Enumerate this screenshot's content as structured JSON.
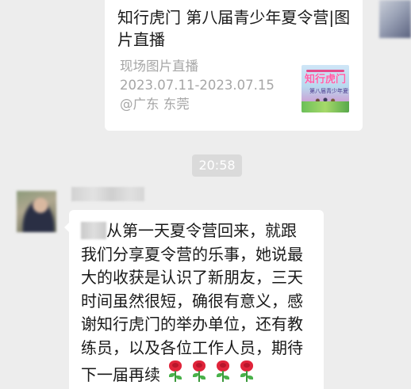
{
  "card": {
    "title": "知行虎门 第八届青少年夏令营|图片直播",
    "desc_line1": "现场图片直播",
    "desc_line2": "2023.07.11-2023.07.15",
    "desc_line3": "@广东 东莞",
    "thumb_title": "知行虎门",
    "thumb_sub": "第八届青少年夏令营"
  },
  "timestamp": "20:58",
  "message": {
    "lines": [
      "从第一天夏令营回来，就跟",
      "我们分享夏令营的乐事，她说最",
      "大的收获是认识了新朋友，三天",
      "时间虽然很短，确很有意义，感",
      "谢知行虎门的举办单位，还有教",
      "练员，以及各位工作人员，期待",
      "下一届再续"
    ]
  },
  "icons": {
    "rose": "rose-emoji-icon",
    "avatar": "user-avatar"
  }
}
